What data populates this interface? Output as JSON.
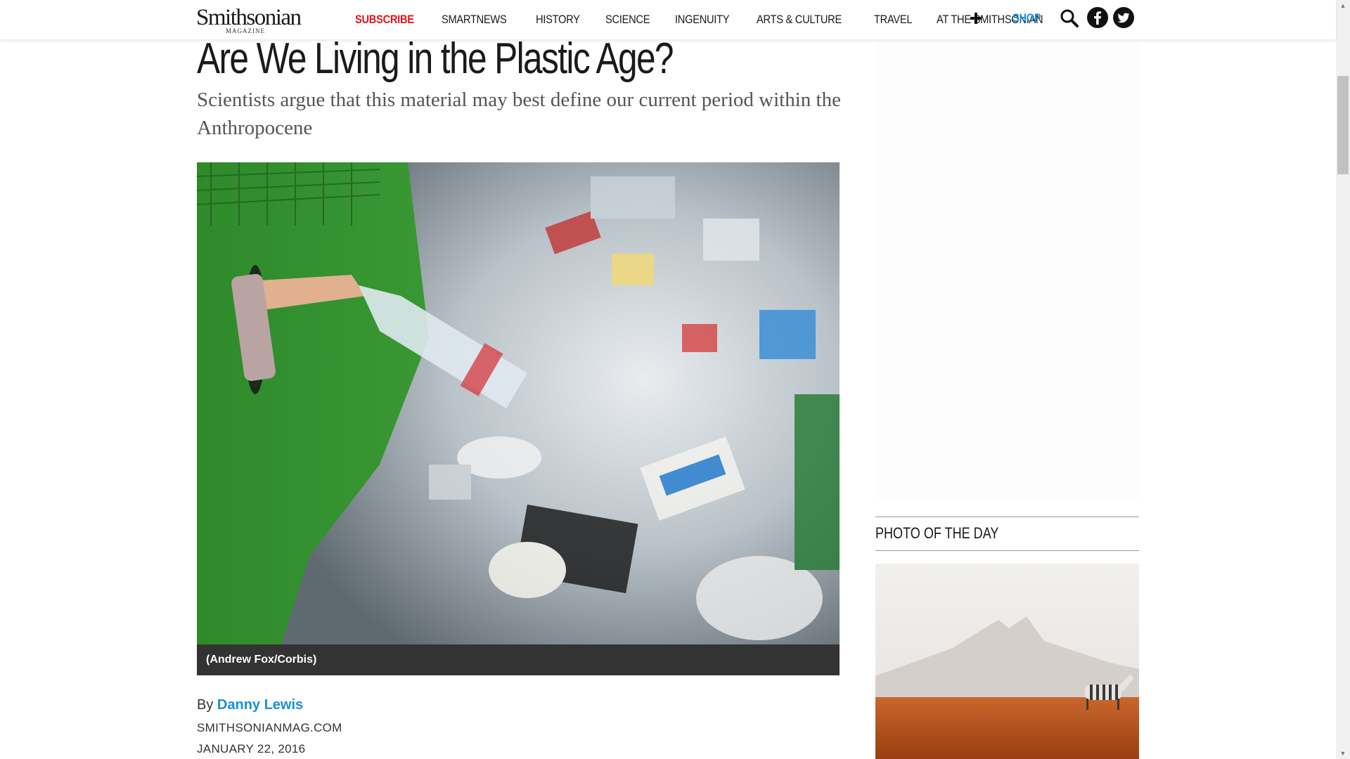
{
  "header": {
    "logo_main": "Smithsonian",
    "logo_sub": "MAGAZINE",
    "nav": [
      {
        "label": "SUBSCRIBE"
      },
      {
        "label": "SMARTNEWS"
      },
      {
        "label": "HISTORY"
      },
      {
        "label": "SCIENCE"
      },
      {
        "label": "INGENUITY"
      },
      {
        "label": "ARTS & CULTURE"
      },
      {
        "label": "TRAVEL"
      },
      {
        "label": "AT THE SMITHSONIAN"
      }
    ],
    "shop_label": "SHOP",
    "icons": [
      "plus-icon",
      "search-icon",
      "facebook-icon",
      "twitter-icon"
    ]
  },
  "article": {
    "title": "Are We Living in the Plastic Age?",
    "dek": "Scientists argue that this material may best define our current period within the Anthropocene",
    "photo_credit": "(Andrew Fox/Corbis)",
    "byline_prefix": "By ",
    "author": "Danny Lewis",
    "source": "SMITHSONIANMAG.COM",
    "date": "JANUARY 22, 2016"
  },
  "sidebar": {
    "photo_of_the_day_title": "PHOTO OF THE DAY"
  },
  "colors": {
    "subscribe_red": "#e2141b",
    "shop_blue": "#1a8fd6",
    "author_blue": "#1a8fd6",
    "caption_bar": "#333333"
  }
}
